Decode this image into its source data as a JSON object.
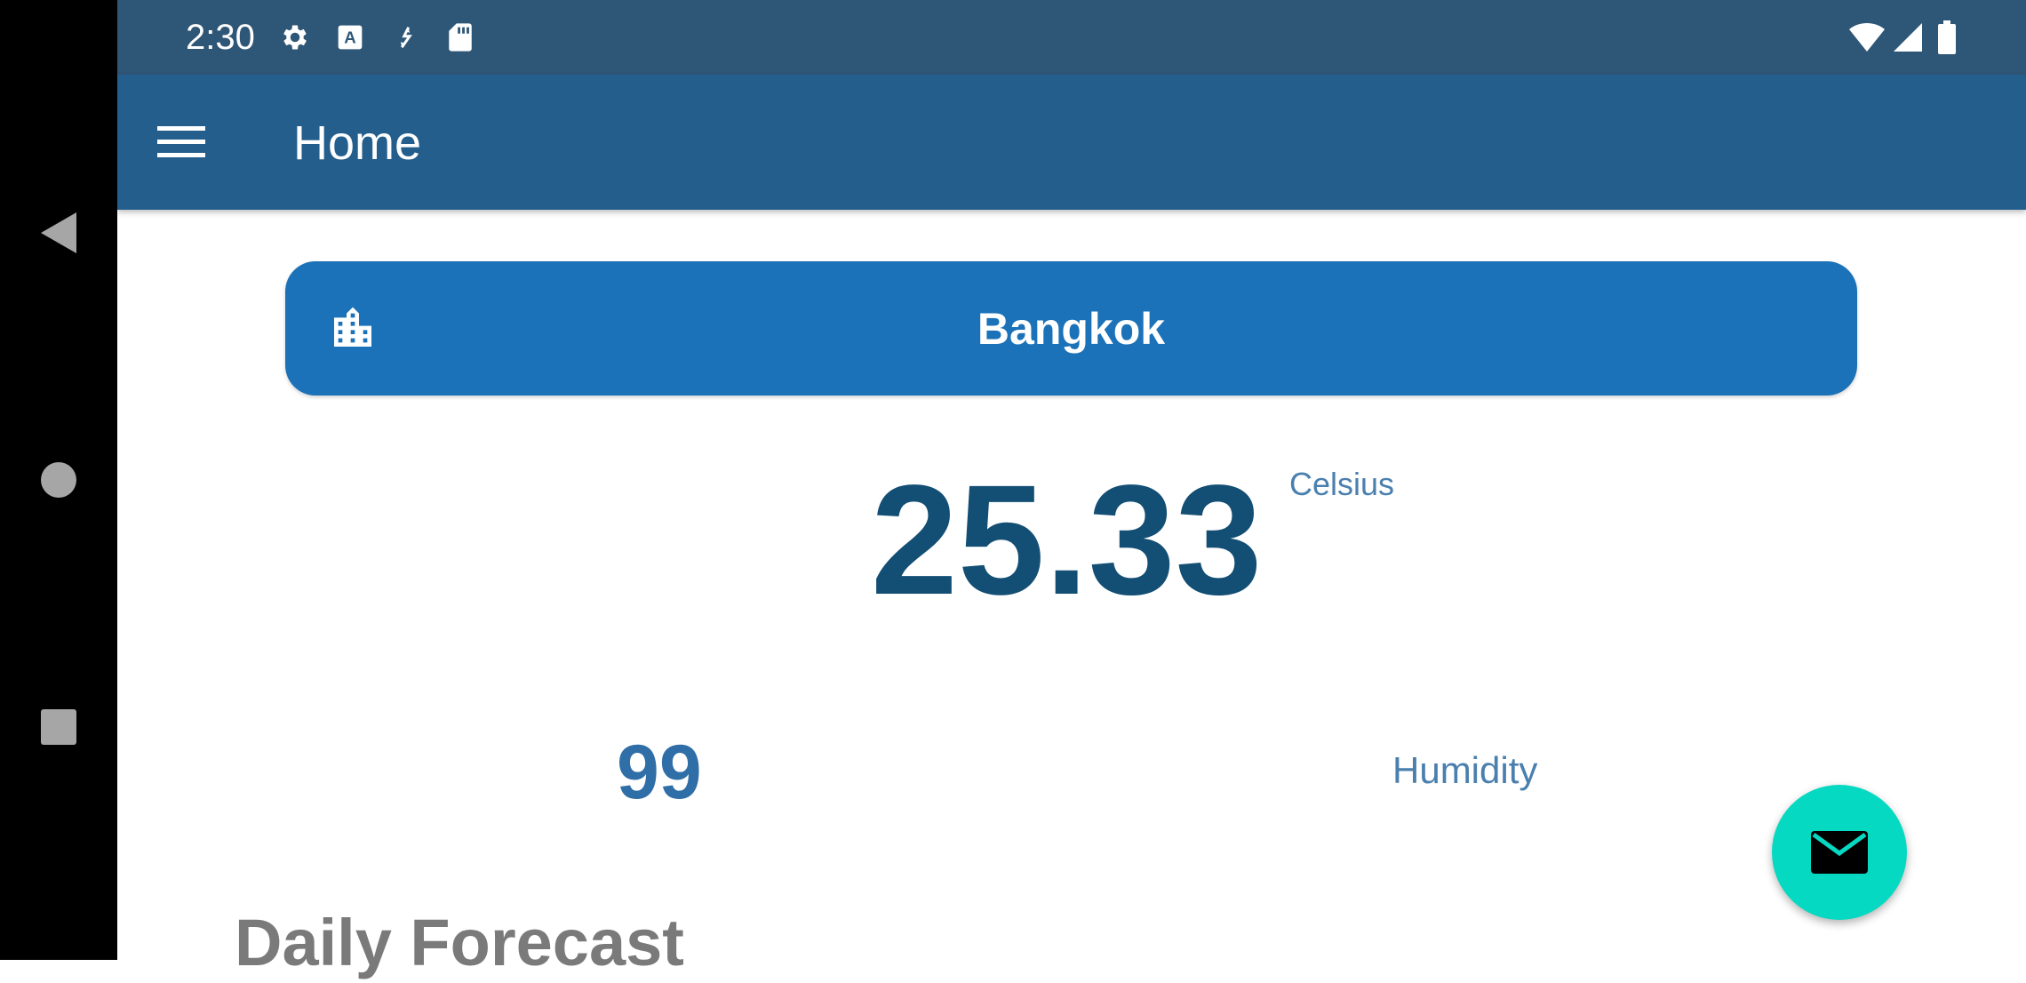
{
  "status_bar": {
    "time": "2:30",
    "left_icons": [
      "gear-icon",
      "a-font-icon",
      "sync-icon",
      "sd-card-icon"
    ],
    "right_icons": [
      "wifi-icon",
      "signal-icon",
      "battery-icon"
    ]
  },
  "navigation_bar": {
    "buttons": [
      "back-icon",
      "home-icon",
      "recents-icon"
    ]
  },
  "app_bar": {
    "title": "Home",
    "menu_icon": "menu-icon"
  },
  "city": {
    "icon": "city-icon",
    "name": "Bangkok"
  },
  "temperature": {
    "value": "25.33",
    "unit": "Celsius"
  },
  "humidity": {
    "value": "99",
    "label": "Humidity"
  },
  "forecast": {
    "title": "Daily Forecast"
  },
  "fab": {
    "icon": "mail-icon"
  },
  "colors": {
    "status_bar": "#2e5676",
    "app_bar": "#235e8c",
    "city_button": "#1b72b9",
    "temperature": "#134e74",
    "humidity_value": "#2f6ea6",
    "fab": "#06d9c1"
  }
}
